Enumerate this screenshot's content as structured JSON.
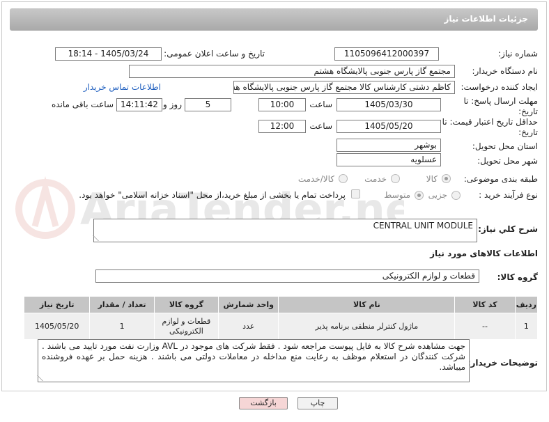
{
  "header": {
    "title": "جزئیات اطلاعات نیاز"
  },
  "need_number": {
    "label": "شماره نیاز:",
    "value": "1105096412000397"
  },
  "announce_datetime": {
    "label": "تاریخ و ساعت اعلان عمومی:",
    "value": "1405/03/24 - 18:14"
  },
  "buyer_org": {
    "label": "نام دستگاه خریدار:",
    "value": "مجتمع گاز پارس جنوبی  پالایشگاه هشتم"
  },
  "requester": {
    "label": "ایجاد کننده درخواست:",
    "value": "کاظم دشتی کارشناس کالا مجتمع گاز پارس جنوبی  پالایشگاه هشتم",
    "contact_link": "اطلاعات تماس خریدار"
  },
  "reply_deadline": {
    "label": "مهلت ارسال پاسخ: تا تاریخ:",
    "date": "1405/03/30",
    "time_label": "ساعت",
    "time": "10:00",
    "days": "5",
    "days_label": "روز و",
    "remaining": "14:11:42",
    "remaining_label": "ساعت باقی مانده"
  },
  "price_validity": {
    "label": "حداقل تاریخ اعتبار قیمت: تا تاریخ:",
    "date": "1405/05/20",
    "time_label": "ساعت",
    "time": "12:00"
  },
  "province": {
    "label": "استان محل تحویل:",
    "value": "بوشهر"
  },
  "city": {
    "label": "شهر محل تحویل:",
    "value": "عسلویه"
  },
  "category": {
    "label": "طبقه بندی موضوعی:",
    "options": [
      "کالا",
      "خدمت",
      "کالا/خدمت"
    ]
  },
  "process": {
    "label": "نوع فرآیند خرید :",
    "options": [
      "جزیی",
      "متوسط"
    ],
    "payment_note": "پرداخت تمام یا بخشی از مبلغ خرید،از محل \"اسناد خزانه اسلامی\" خواهد بود."
  },
  "general_desc": {
    "label": "شرح کلي نياز:",
    "value": "CENTRAL UNIT MODULE"
  },
  "goods_section": {
    "title": "اطلاعات کالاهای مورد نیاز"
  },
  "goods_group": {
    "label": "گروه کالا:",
    "value": "قطعات و لوازم الکترونیکی"
  },
  "table": {
    "headers": [
      "ردیف",
      "کد کالا",
      "نام کالا",
      "واحد شمارش",
      "گروه کالا",
      "تعداد / مقدار",
      "تاریخ نیاز"
    ],
    "rows": [
      [
        "1",
        "--",
        "ماژول کنترلر منطقی برنامه پذیر",
        "عدد",
        "قطعات و لوازم الکترونیکی",
        "1",
        "1405/05/20"
      ]
    ]
  },
  "buyer_notes": {
    "label": "توضیحات خریدار:",
    "value": "جهت مشاهده شرح کالا به فایل پیوست مراجعه شود . فقط شرکت های موجود در AVL وزارت نفت مورد تایید می باشند . شرکت کنندگان در استعلام موظف به رعایت منع مداخله در معاملات دولتی می باشند . هزینه حمل بر عهده فروشنده میباشد."
  },
  "buttons": {
    "print": "چاپ",
    "back": "بازگشت"
  },
  "watermark": {
    "text": "AriaTender.net"
  },
  "colors": {
    "header": "#b5b5b5",
    "link": "#1f5fbf",
    "back_button": "#f6d6d6",
    "print_button": "#f2f2f2"
  }
}
